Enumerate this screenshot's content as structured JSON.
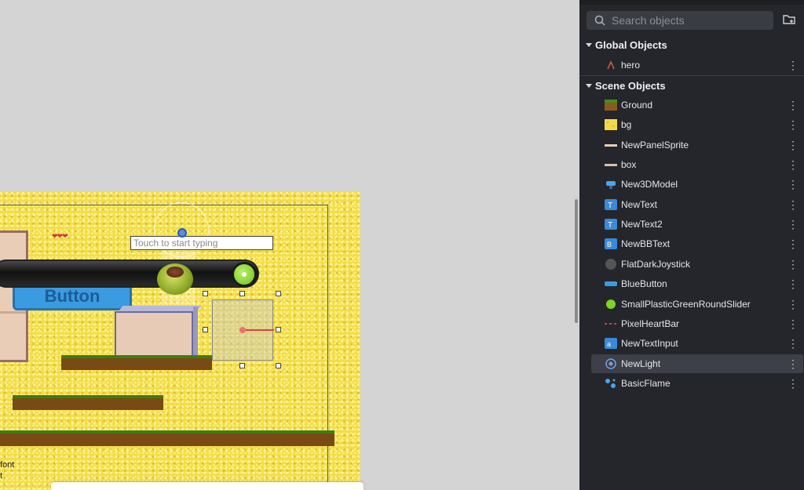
{
  "canvas": {
    "text_input_placeholder": "Touch to start typing",
    "button_label": "Button",
    "hearts": "❤❤❤",
    "corner_text_1": "font",
    "corner_text_2": "t"
  },
  "panel": {
    "search_placeholder": "Search objects",
    "global_section_label": "Global Objects",
    "scene_section_label": "Scene Objects",
    "global_objects": [
      {
        "name": "hero",
        "icon": "hero-sprite-icon"
      }
    ],
    "scene_objects": [
      {
        "name": "Ground",
        "icon": "ground-tile-icon"
      },
      {
        "name": "bg",
        "icon": "bg-tile-icon"
      },
      {
        "name": "NewPanelSprite",
        "icon": "panel-sprite-icon"
      },
      {
        "name": "box",
        "icon": "box-sprite-icon"
      },
      {
        "name": "New3DModel",
        "icon": "3d-model-icon"
      },
      {
        "name": "NewText",
        "icon": "text-icon"
      },
      {
        "name": "NewText2",
        "icon": "text-icon"
      },
      {
        "name": "NewBBText",
        "icon": "bbtext-icon"
      },
      {
        "name": "FlatDarkJoystick",
        "icon": "joystick-icon"
      },
      {
        "name": "BlueButton",
        "icon": "button-icon"
      },
      {
        "name": "SmallPlasticGreenRoundSlider",
        "icon": "slider-icon"
      },
      {
        "name": "PixelHeartBar",
        "icon": "heart-bar-icon"
      },
      {
        "name": "NewTextInput",
        "icon": "text-input-icon"
      },
      {
        "name": "NewLight",
        "icon": "light-icon",
        "selected": true
      },
      {
        "name": "BasicFlame",
        "icon": "particles-icon"
      }
    ],
    "more_glyph": "⋮",
    "colors": {
      "panel_bg": "#25262b",
      "selected_row": "#3d4049",
      "accent_blue": "#3a9be0"
    }
  }
}
